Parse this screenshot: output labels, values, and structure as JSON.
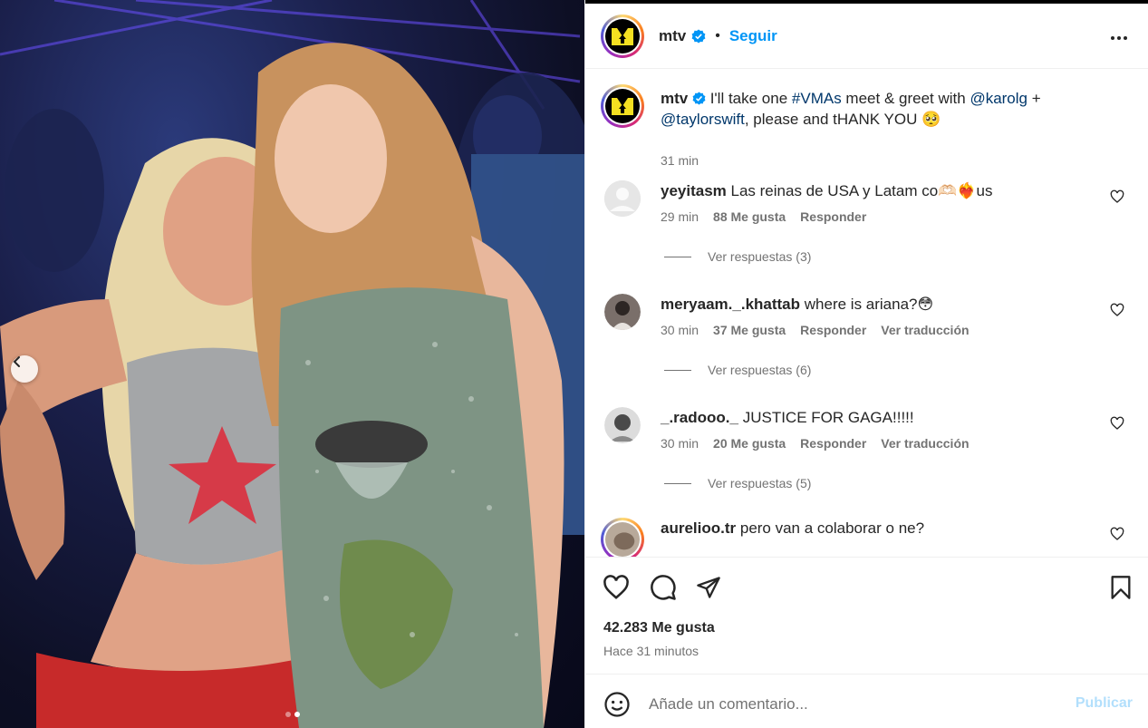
{
  "post": {
    "author": "mtv",
    "follow_label": "Seguir",
    "separator": "•"
  },
  "caption": {
    "username": "mtv",
    "text_before": "I'll take one ",
    "hashtag": "#VMAs",
    "text_mid": " meet & greet with ",
    "mention1": "@karolg",
    "plus": " +",
    "mention2": "@taylorswift",
    "text_after": ", please and tHANK YOU 🥺",
    "time": "31 min"
  },
  "comments": [
    {
      "username": "yeyitasm",
      "text": "Las reinas de USA y Latam co🫶🏻❤️‍🔥us",
      "time": "29 min",
      "likes": "88 Me gusta",
      "reply": "Responder",
      "translate": "",
      "replies": "Ver respuestas (3)"
    },
    {
      "username": "meryaam._.khattab",
      "text": "where is ariana?😳",
      "time": "30 min",
      "likes": "37 Me gusta",
      "reply": "Responder",
      "translate": "Ver traducción",
      "replies": "Ver respuestas (6)"
    },
    {
      "username": "_.radooo._",
      "text": "JUSTICE FOR GAGA!!!!!",
      "time": "30 min",
      "likes": "20 Me gusta",
      "reply": "Responder",
      "translate": "Ver traducción",
      "replies": "Ver respuestas (5)"
    },
    {
      "username": "aurelioo.tr",
      "text": "pero van a colaborar o ne?",
      "time": "",
      "likes": "",
      "reply": "",
      "translate": "",
      "replies": ""
    }
  ],
  "stats": {
    "likes": "42.283 Me gusta",
    "time": "Hace 31 minutos"
  },
  "composer": {
    "placeholder": "Añade un comentario...",
    "publish_label": "Publicar"
  },
  "icons": {
    "like": "heart-icon",
    "comment": "comment-icon",
    "share": "share-icon",
    "save": "bookmark-icon",
    "more": "more-icon",
    "emoji": "emoji-icon",
    "verified": "verified-badge-icon"
  },
  "colors": {
    "link": "#00376b",
    "follow": "#0095f6",
    "muted": "#737373",
    "publish_disabled": "#b2dffc"
  }
}
